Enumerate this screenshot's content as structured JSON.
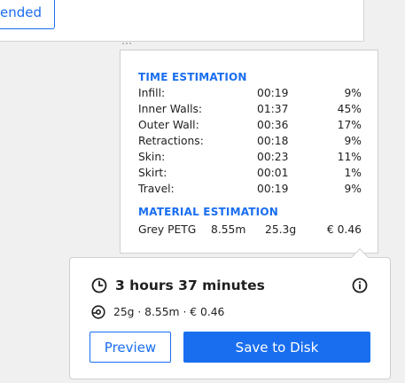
{
  "top_panel": {
    "recommended_label": "ended"
  },
  "estimation": {
    "time_title": "TIME ESTIMATION",
    "time_rows": [
      {
        "label": "Infill:",
        "time": "00:19",
        "pct": "9%"
      },
      {
        "label": "Inner Walls:",
        "time": "01:37",
        "pct": "45%"
      },
      {
        "label": "Outer Wall:",
        "time": "00:36",
        "pct": "17%"
      },
      {
        "label": "Retractions:",
        "time": "00:18",
        "pct": "9%"
      },
      {
        "label": "Skin:",
        "time": "00:23",
        "pct": "11%"
      },
      {
        "label": "Skirt:",
        "time": "00:01",
        "pct": "1%"
      },
      {
        "label": "Travel:",
        "time": "00:19",
        "pct": "9%"
      }
    ],
    "material_title": "MATERIAL ESTIMATION",
    "material": {
      "name": "Grey PETG",
      "length": "8.55m",
      "weight": "25.3g",
      "cost": "€ 0.46"
    }
  },
  "action_panel": {
    "print_time": "3 hours 37 minutes",
    "material_summary": "25g · 8.55m · € 0.46",
    "preview_label": "Preview",
    "save_label": "Save to Disk",
    "icons": {
      "time": "clock-icon",
      "info": "info-icon",
      "material": "spool-icon"
    }
  },
  "colors": {
    "accent": "#196ef0",
    "background": "#f0f0f0",
    "panel": "#ffffff",
    "border": "#cfcfcf"
  }
}
